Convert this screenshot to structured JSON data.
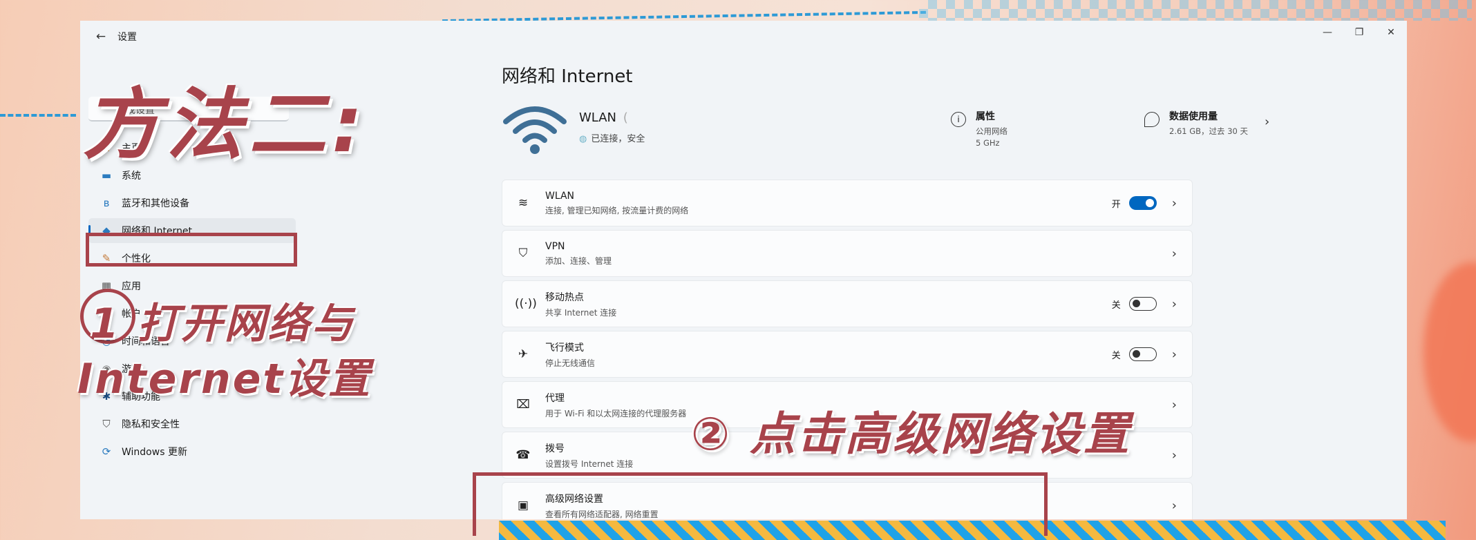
{
  "window": {
    "title": "设置",
    "back_icon": "←",
    "controls": [
      "—",
      "❐",
      "✕"
    ]
  },
  "sidebar": {
    "search_placeholder": "查找设置",
    "items": [
      {
        "label": "主页",
        "icon": "home-icon",
        "glyph": "⌂",
        "color": "#d9892f",
        "active": false
      },
      {
        "label": "系统",
        "icon": "system-icon",
        "glyph": "▬",
        "color": "#2b7bbf",
        "active": false
      },
      {
        "label": "蓝牙和其他设备",
        "icon": "bluetooth-icon",
        "glyph": "ʙ",
        "color": "#2b7bbf",
        "active": false
      },
      {
        "label": "网络和 Internet",
        "icon": "network-icon",
        "glyph": "◆",
        "color": "#2b7bbf",
        "active": true
      },
      {
        "label": "个性化",
        "icon": "brush-icon",
        "glyph": "✎",
        "color": "#c47a3a",
        "active": false
      },
      {
        "label": "应用",
        "icon": "apps-icon",
        "glyph": "▦",
        "color": "#555555",
        "active": false
      },
      {
        "label": "帐户",
        "icon": "account-icon",
        "glyph": "●",
        "color": "#2ea36b",
        "active": false
      },
      {
        "label": "时间和语言",
        "icon": "clock-icon",
        "glyph": "◔",
        "color": "#2b7bbf",
        "active": false
      },
      {
        "label": "游戏",
        "icon": "game-icon",
        "glyph": "◉",
        "color": "#777777",
        "active": false
      },
      {
        "label": "辅助功能",
        "icon": "accessibility-icon",
        "glyph": "✱",
        "color": "#1c4f86",
        "active": false
      },
      {
        "label": "隐私和安全性",
        "icon": "shield-icon",
        "glyph": "⛉",
        "color": "#555555",
        "active": false
      },
      {
        "label": "Windows 更新",
        "icon": "update-icon",
        "glyph": "⟳",
        "color": "#2b7bbf",
        "active": false
      }
    ]
  },
  "main": {
    "page_title": "网络和 Internet",
    "hero": {
      "name": "WLAN",
      "name_suffix": "(",
      "status": "已连接，安全",
      "properties": {
        "title": "属性",
        "line1": "公用网络",
        "line2": "5 GHz"
      },
      "data_usage": {
        "title": "数据使用量",
        "line1": "2.61 GB，过去 30 天"
      }
    },
    "cards": [
      {
        "title": "WLAN",
        "sub": "连接, 管理已知网络, 按流量计费的网络",
        "icon": "wifi-icon",
        "glyph": "≋",
        "toggle": "on",
        "toggle_label": "开"
      },
      {
        "title": "VPN",
        "sub": "添加、连接、管理",
        "icon": "vpn-shield-icon",
        "glyph": "⛉",
        "toggle": null,
        "toggle_label": ""
      },
      {
        "title": "移动热点",
        "sub": "共享 Internet 连接",
        "icon": "hotspot-icon",
        "glyph": "((·))",
        "toggle": "off",
        "toggle_label": "关"
      },
      {
        "title": "飞行模式",
        "sub": "停止无线通信",
        "icon": "airplane-icon",
        "glyph": "✈",
        "toggle": "off",
        "toggle_label": "关"
      },
      {
        "title": "代理",
        "sub": "用于 Wi-Fi 和以太网连接的代理服务器",
        "icon": "proxy-icon",
        "glyph": "⌧",
        "toggle": null,
        "toggle_label": ""
      },
      {
        "title": "拨号",
        "sub": "设置拨号 Internet 连接",
        "icon": "dialup-icon",
        "glyph": "☎",
        "toggle": null,
        "toggle_label": ""
      },
      {
        "title": "高级网络设置",
        "sub": "查看所有网络适配器, 网络重置",
        "icon": "monitor-icon",
        "glyph": "▣",
        "toggle": null,
        "toggle_label": ""
      }
    ]
  },
  "overlay": {
    "heading": "方法二:",
    "step1_line1": "1 打开网络与",
    "step1_line2": "Internet设置",
    "step2": "② 点击高级网络设置"
  }
}
